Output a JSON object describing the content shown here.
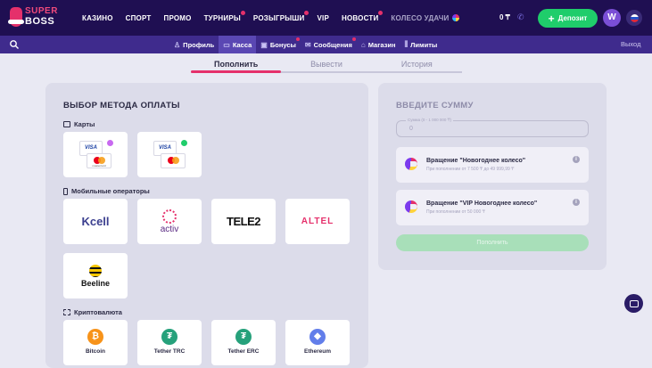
{
  "logo": {
    "line1": "SUPER",
    "line2": "BOSS"
  },
  "nav": {
    "items": [
      {
        "label": "КАЗИНО"
      },
      {
        "label": "СПОРТ"
      },
      {
        "label": "ПРОМО"
      },
      {
        "label": "ТУРНИРЫ"
      },
      {
        "label": "РОЗЫГРЫШИ"
      },
      {
        "label": "VIP"
      },
      {
        "label": "НОВОСТИ"
      },
      {
        "label": "КОЛЕСО УДАЧИ"
      }
    ]
  },
  "header": {
    "balance": "0 ₸",
    "deposit_label": "Депозит",
    "avatar_letter": "W"
  },
  "subnav": {
    "items": [
      {
        "label": "Профиль",
        "icon": "user-icon"
      },
      {
        "label": "Касса",
        "icon": "wallet-icon"
      },
      {
        "label": "Бонусы",
        "icon": "gift-icon"
      },
      {
        "label": "Сообщения",
        "icon": "mail-icon"
      },
      {
        "label": "Магазин",
        "icon": "shop-icon"
      },
      {
        "label": "Лимиты",
        "icon": "limits-icon"
      }
    ],
    "logout": "Выход"
  },
  "tabs": [
    {
      "label": "Пополнить"
    },
    {
      "label": "Вывести"
    },
    {
      "label": "История"
    }
  ],
  "methods": {
    "title": "ВЫБОР МЕТОДА ОПЛАТЫ",
    "sections": {
      "cards": "Карты",
      "mobile": "Мобильные операторы",
      "crypto": "Криптовалюта"
    },
    "card_brand": "VISA",
    "card_sub": "mastercard",
    "operators": [
      "Kcell",
      "activ",
      "TELE2",
      "ALTEL",
      "Beeline"
    ],
    "crypto": [
      "Bitcoin",
      "Tether TRC",
      "Tether ERC",
      "Ethereum"
    ]
  },
  "amount": {
    "title": "ВВЕДИТЕ СУММУ",
    "field_label": "Сумма (0 - 1 000 000 ₸)",
    "field_value": "0",
    "bonuses": [
      {
        "title": "Вращение \"Новогоднее колесо\"",
        "subtitle": "При пополнении от 7 500 ₸ до 49 999,99 ₸"
      },
      {
        "title": "Вращение \"VIP Новогоднее колесо\"",
        "subtitle": "При пополнении от 50 000 ₸"
      }
    ],
    "submit_label": "Пополнить"
  },
  "colors": {
    "accent": "#e5306b",
    "green": "#1fcd6b",
    "header": "#1f0f52",
    "subbar": "#3f2b8d"
  }
}
